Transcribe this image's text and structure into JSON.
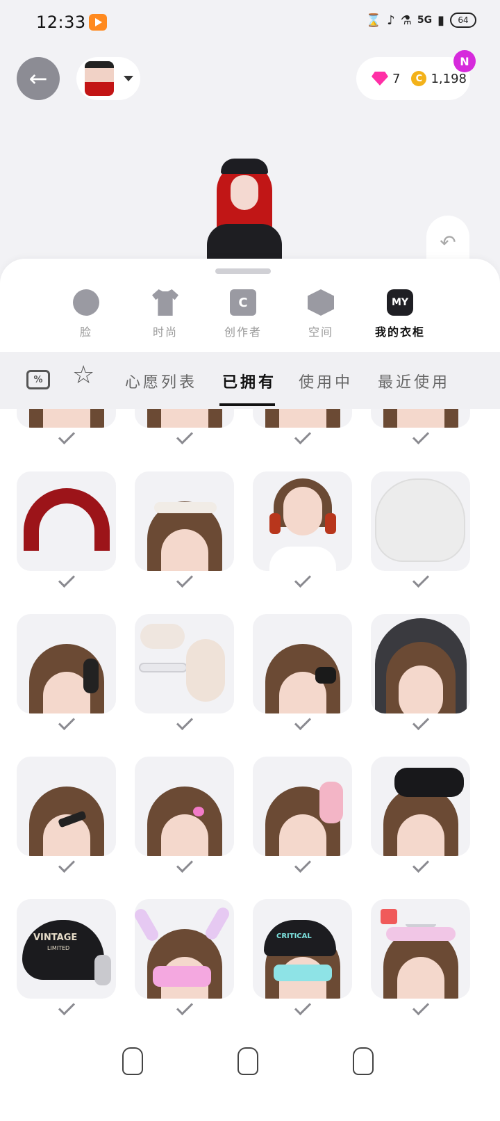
{
  "status_bar": {
    "time": "12:33",
    "network": "5G",
    "battery": "64"
  },
  "wallet": {
    "gems": "7",
    "coins": "1,198",
    "notification_badge": "N"
  },
  "categories": [
    {
      "label": "脸",
      "icon": "face-icon"
    },
    {
      "label": "时尚",
      "icon": "shirt-icon"
    },
    {
      "label": "创作者",
      "icon": "creator-bag-icon",
      "glyph": "C"
    },
    {
      "label": "空间",
      "icon": "cube-icon"
    },
    {
      "label": "我的衣柜",
      "icon": "my-closet-icon",
      "glyph": "MY",
      "active": true
    }
  ],
  "filter_tabs": [
    {
      "label": "心愿列表"
    },
    {
      "label": "已拥有",
      "active": true
    },
    {
      "label": "使用中"
    },
    {
      "label": "最近使用"
    }
  ],
  "coupon_glyph": "%",
  "items": [
    {
      "name": "red-fur-headband",
      "owned": true
    },
    {
      "name": "lace-headband",
      "owned": true
    },
    {
      "name": "red-ribbon-pigtails",
      "owned": true
    },
    {
      "name": "white-beanie",
      "owned": true
    },
    {
      "name": "black-headphones",
      "owned": true
    },
    {
      "name": "white-hair-accessory-set",
      "owned": true
    },
    {
      "name": "black-bow-clip",
      "owned": true
    },
    {
      "name": "black-lace-veil",
      "owned": true
    },
    {
      "name": "rhinestone-hair-clip",
      "owned": true
    },
    {
      "name": "butterfly-clips",
      "owned": true
    },
    {
      "name": "pink-bow",
      "owned": true
    },
    {
      "name": "large-black-bow",
      "owned": true
    },
    {
      "name": "vintage-cap-headphones",
      "owned": true,
      "text": "VINTAGE",
      "subtext": "LIMITED"
    },
    {
      "name": "bunny-ears-visor",
      "owned": true
    },
    {
      "name": "critical-cap-visor",
      "owned": true,
      "text": "CRITICAL"
    },
    {
      "name": "cat-ear-tiara",
      "owned": true
    }
  ],
  "colors": {
    "accent": "#111111",
    "gem": "#ff2fa6",
    "coin": "#f3b21a",
    "badge": "#d62adc"
  }
}
